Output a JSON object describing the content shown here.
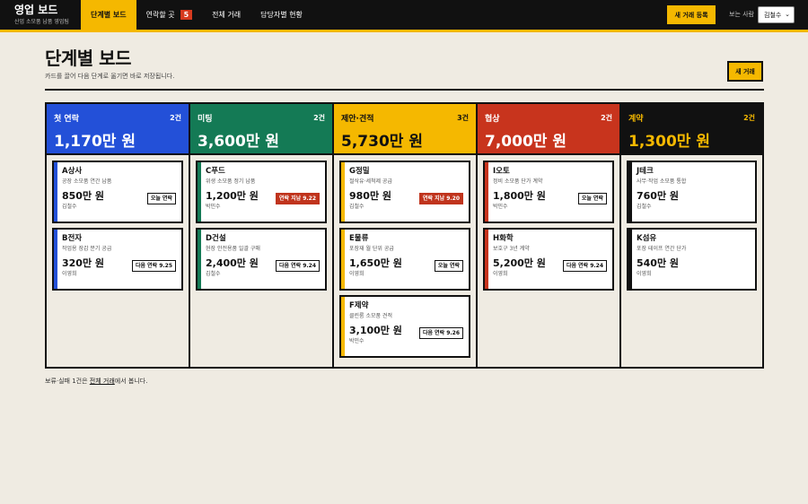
{
  "app": {
    "title": "영업 보드",
    "subtitle": "산업 소모품 납품 영업팀"
  },
  "nav": {
    "tabs": [
      {
        "label": "단계별 보드"
      },
      {
        "label": "연락할 곳",
        "badge": "5"
      },
      {
        "label": "전체 거래"
      },
      {
        "label": "담당자별 현황"
      }
    ],
    "new_deal_label": "새 거래 등록",
    "viewer_label": "보는 사람",
    "viewer_value": "김철수"
  },
  "page": {
    "title": "단계별 보드",
    "description": "카드를 끌어 다음 단계로 옮기면 바로 저장됩니다.",
    "new_button": "새 거래"
  },
  "colors": {
    "accent": "#f5b800",
    "overdue": "#c0341d"
  },
  "columns": [
    {
      "name": "첫 연락",
      "count": "2건",
      "total": "1,170만 원",
      "color": "#2350d8",
      "text": "#ffffff",
      "cards": [
        {
          "name": "A상사",
          "desc": "공장 소모품 연간 납품",
          "amount": "850만 원",
          "owner": "김철수",
          "badge": "오늘 연락",
          "overdue": false
        },
        {
          "name": "B전자",
          "desc": "작업용 장갑 분기 공급",
          "amount": "320만 원",
          "owner": "이영희",
          "badge": "다음 연락 9.25",
          "overdue": false
        }
      ]
    },
    {
      "name": "미팅",
      "count": "2건",
      "total": "3,600만 원",
      "color": "#147a55",
      "text": "#ffffff",
      "cards": [
        {
          "name": "C푸드",
          "desc": "위생 소모품 정기 납품",
          "amount": "1,200만 원",
          "owner": "박민수",
          "badge": "연락 지남 9.22",
          "overdue": true
        },
        {
          "name": "D건설",
          "desc": "현장 안전용품 일괄 구매",
          "amount": "2,400만 원",
          "owner": "김철수",
          "badge": "다음 연락 9.24",
          "overdue": false
        }
      ]
    },
    {
      "name": "제안·견적",
      "count": "3건",
      "total": "5,730만 원",
      "color": "#f5b800",
      "text": "#111111",
      "cards": [
        {
          "name": "G정밀",
          "desc": "절삭유·세척제 공급",
          "amount": "980만 원",
          "owner": "김철수",
          "badge": "연락 지남 9.20",
          "overdue": true
        },
        {
          "name": "E물류",
          "desc": "포장재 월 단위 공급",
          "amount": "1,650만 원",
          "owner": "이영희",
          "badge": "오늘 연락",
          "overdue": false
        },
        {
          "name": "F제약",
          "desc": "클린룸 소모품 견적",
          "amount": "3,100만 원",
          "owner": "박민수",
          "badge": "다음 연락 9.26",
          "overdue": false
        }
      ]
    },
    {
      "name": "협상",
      "count": "2건",
      "total": "7,000만 원",
      "color": "#c8341d",
      "text": "#ffffff",
      "cards": [
        {
          "name": "I오토",
          "desc": "정비 소모품 단가 계약",
          "amount": "1,800만 원",
          "owner": "박민수",
          "badge": "오늘 연락",
          "overdue": false
        },
        {
          "name": "H화학",
          "desc": "보호구 3년 계약",
          "amount": "5,200만 원",
          "owner": "이영희",
          "badge": "다음 연락 9.24",
          "overdue": false
        }
      ]
    },
    {
      "name": "계약",
      "count": "2건",
      "total": "1,300만 원",
      "color": "#111111",
      "text": "#f5b800",
      "cards": [
        {
          "name": "J테크",
          "desc": "사무·작업 소모품 통합",
          "amount": "760만 원",
          "owner": "김철수",
          "badge": "",
          "overdue": false
        },
        {
          "name": "K섬유",
          "desc": "포장 테이프 연간 단가",
          "amount": "540만 원",
          "owner": "이영희",
          "badge": "",
          "overdue": false
        }
      ]
    }
  ],
  "footer": {
    "prefix": "보류·실패 1건은 ",
    "link": "전체 거래",
    "suffix": "에서 봅니다."
  }
}
